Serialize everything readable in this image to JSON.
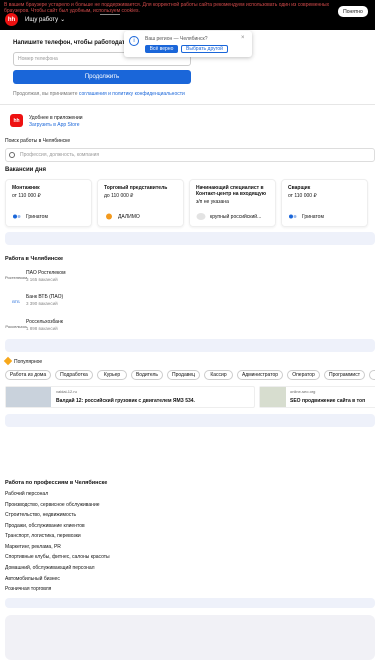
{
  "banner": {
    "text": "В вашем браузере устарело и больше не поддерживается. Для корректной работы сайта рекомендуем использовать один из современных браузеров. Чтобы сайт был удобным, используем cookies.",
    "understood_label": "Понятно"
  },
  "header": {
    "logo_text": "hh",
    "menu_label": "Ищу работу"
  },
  "region_popup": {
    "question": "Ваш регион — Челябинск?",
    "yes_label": "Всё верно",
    "other_label": "Выбрать другой"
  },
  "phone_form": {
    "title": "Напишите телефон, чтобы работодатели могли",
    "placeholder": "Номер телефона",
    "continue_label": "Продолжить",
    "consent_prefix": "Продолжая, вы принимаете",
    "consent_link": "соглашения и политику конфиденциальности"
  },
  "app_promo": {
    "logo_text": "hh",
    "title": "Удобнее в приложении",
    "link": "Загрузить в App Store"
  },
  "search": {
    "label": "Поиск работы в Челябинске",
    "placeholder": "Профессия, должность, компания"
  },
  "vacancies": {
    "title": "Вакансии дня",
    "items": [
      {
        "title": "Монтажник",
        "salary": "от 110 000 ₽",
        "company": "Гринатом"
      },
      {
        "title": "Торговый представитель",
        "salary": "до 110 000 ₽",
        "company": "ДАЛИМО"
      },
      {
        "title": "Начинающий специалист в Контакт-центр на входящую",
        "salary": "з/п не указана",
        "company": "крупный российский..."
      },
      {
        "title": "Сварщик",
        "salary": "от 110 000 ₽",
        "company": "Гринатом"
      }
    ]
  },
  "employers": {
    "title": "Работа в Челябинске",
    "items": [
      {
        "logo": "Ростелеком",
        "name": "ПАО Ростелеком",
        "vacancies": "3 165 вакансий"
      },
      {
        "logo": "ВТБ",
        "name": "Банк ВТБ (ПАО)",
        "vacancies": "3 390 вакансий"
      },
      {
        "logo": "Россельхоз",
        "name": "Россельхозбанк",
        "vacancies": "1 898 вакансий"
      }
    ]
  },
  "popular": {
    "label": "Популярное",
    "chips": [
      "Работа из дома",
      "Подработка",
      "Курьер",
      "Водитель",
      "Продавец",
      "Кассир",
      "Администратор",
      "Оператор",
      "Программист"
    ]
  },
  "ads": [
    {
      "domain": "valdai-12.ru",
      "text": "Валдай 12: российский грузовик с двигателем ЯМЗ 534."
    },
    {
      "domain": "online-seo.org",
      "text": "SEO продвижение сайта в топ"
    }
  ],
  "professions": {
    "title": "Работа по профессиям в Челябинске",
    "items": [
      "Рабочий персонал",
      "Производство, сервисное обслуживание",
      "Строительство, недвижимость",
      "Продажи, обслуживание клиентов",
      "Транспорт, логистика, перевозки",
      "Маркетинг, реклама, PR",
      "Спортивные клубы, фитнес, салоны красоты",
      "Домашний, обслуживающий персонал",
      "Автомобильный бизнес",
      "Розничная торговля"
    ]
  },
  "colors": {
    "accent": "#1a66d9",
    "brand": "#e11111",
    "warning": "#d24a4a"
  }
}
